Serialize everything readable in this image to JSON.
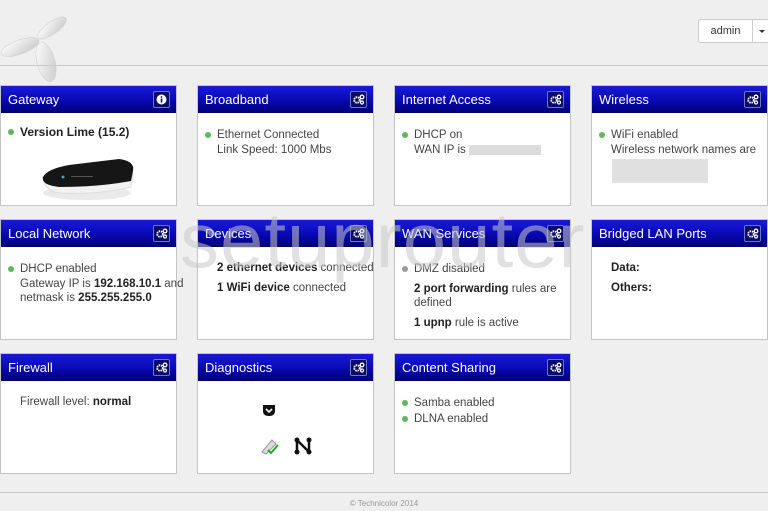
{
  "header": {
    "logo": "telenor-propeller-logo",
    "user_menu": {
      "username": "admin"
    }
  },
  "cards": {
    "gateway": {
      "title": "Gateway",
      "icon": "info-icon",
      "version": "Version Lime (15.2)",
      "status_color": "#5fb85f"
    },
    "broadband": {
      "title": "Broadband",
      "icon": "gears-icon",
      "status": "Ethernet Connected",
      "link_speed": "Link Speed: 1000 Mbs"
    },
    "internet_access": {
      "title": "Internet Access",
      "icon": "gears-icon",
      "status": "DHCP on",
      "wan_ip_label": "WAN IP is"
    },
    "wireless": {
      "title": "Wireless",
      "icon": "gears-icon",
      "status": "WiFi enabled",
      "names_label": "Wireless network names are"
    },
    "local_network": {
      "title": "Local Network",
      "icon": "gears-icon",
      "status": "DHCP enabled",
      "gw_prefix": "Gateway IP is ",
      "gw_ip": "192.168.10.1",
      "gw_suffix": " and",
      "mask_prefix": "netmask is ",
      "netmask": "255.255.255.0"
    },
    "devices": {
      "title": "Devices",
      "icon": "gears-icon",
      "eth_count": "2 ethernet devices",
      "eth_suffix": " connected",
      "wifi_count": "1 WiFi device",
      "wifi_suffix": " connected"
    },
    "wan_services": {
      "title": "WAN Services",
      "icon": "gears-icon",
      "dmz": "DMZ disabled",
      "pf_bold": "2 port forwarding",
      "pf_rest": " rules are",
      "pf_rest2": "defined",
      "upnp_bold": "1 upnp",
      "upnp_rest": " rule is active"
    },
    "bridged_lan": {
      "title": "Bridged LAN Ports",
      "icon": "gears-icon",
      "data_label": "Data:",
      "others_label": "Others:"
    },
    "firewall": {
      "title": "Firewall",
      "icon": "gears-icon",
      "level_label": "Firewall level: ",
      "level": "normal"
    },
    "diagnostics": {
      "title": "Diagnostics",
      "icon": "gears-icon"
    },
    "content_sharing": {
      "title": "Content Sharing",
      "icon": "gears-icon",
      "samba": "Samba enabled",
      "dlna": "DLNA enabled"
    }
  },
  "watermark": "setuprouter",
  "footer": {
    "copyright": "© Technicolor 2014"
  },
  "colors": {
    "header_blue": "#0a0ab8",
    "status_green": "#5fb85f",
    "status_grey": "#999999"
  }
}
